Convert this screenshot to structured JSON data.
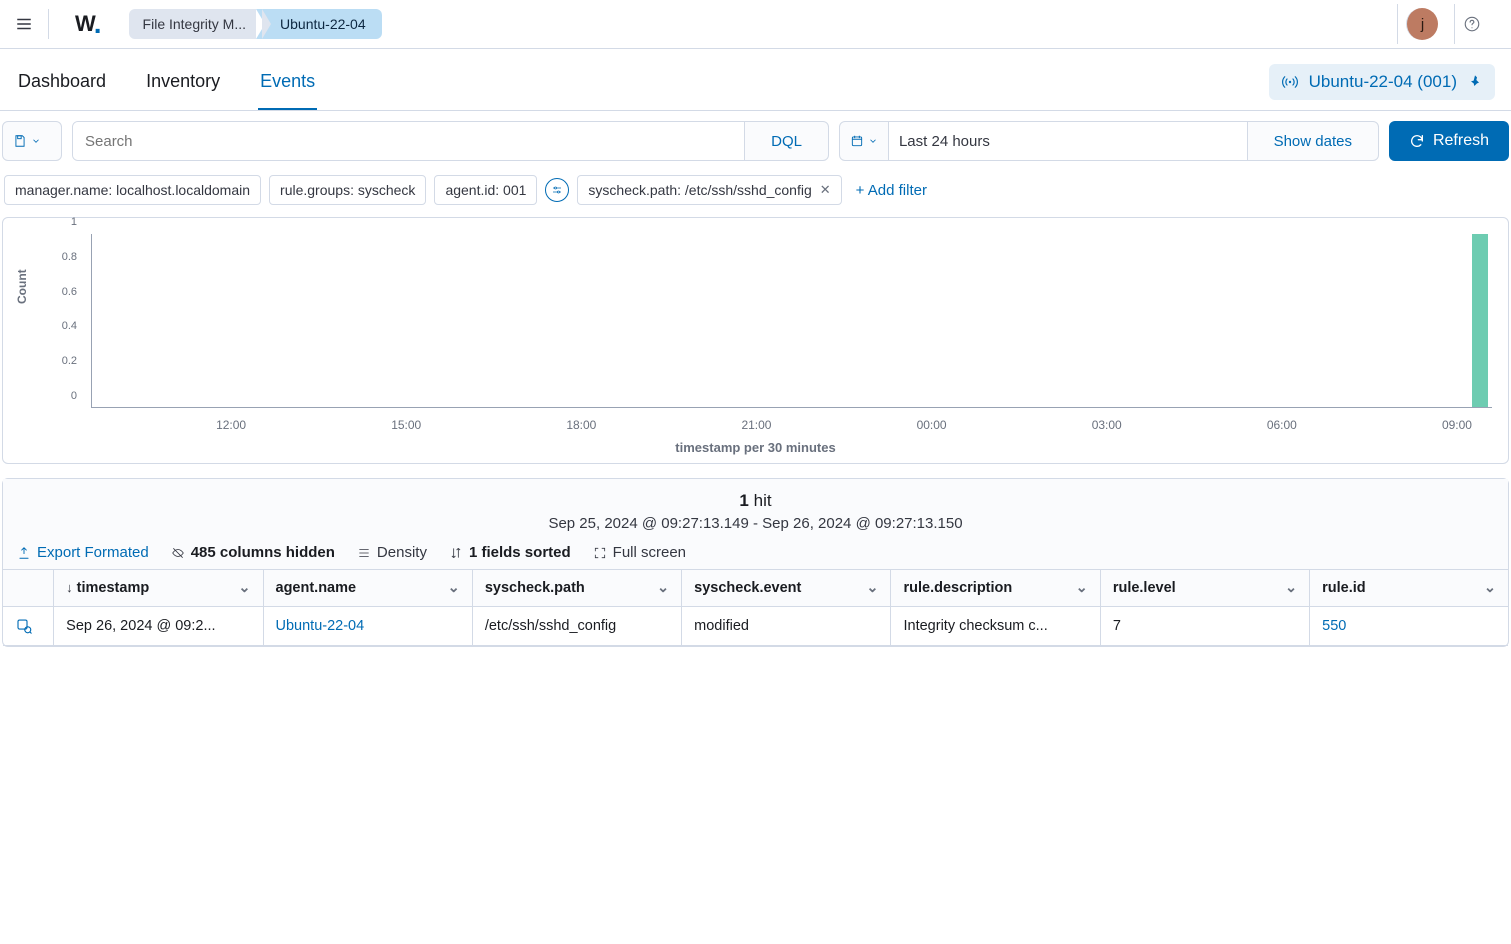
{
  "breadcrumb": {
    "module": "File Integrity M...",
    "agent": "Ubuntu-22-04"
  },
  "user": {
    "avatar_initial": "j"
  },
  "tabs": {
    "dashboard": "Dashboard",
    "inventory": "Inventory",
    "events": "Events"
  },
  "agent_badge": "Ubuntu-22-04 (001)",
  "search": {
    "placeholder": "Search",
    "dql_label": "DQL",
    "timerange": "Last 24 hours",
    "show_dates": "Show dates",
    "refresh": "Refresh"
  },
  "filters": {
    "chips": [
      "manager.name: localhost.localdomain",
      "rule.groups: syscheck",
      "agent.id: 001"
    ],
    "removable_chip": "syscheck.path: /etc/ssh/sshd_config",
    "add_filter": "+ Add filter"
  },
  "chart_data": {
    "type": "bar",
    "ylabel": "Count",
    "xlabel": "timestamp per 30 minutes",
    "ylim": [
      0,
      1
    ],
    "yticks": [
      0,
      0.2,
      0.4,
      0.6,
      0.8,
      1
    ],
    "xticks": [
      "12:00",
      "15:00",
      "18:00",
      "21:00",
      "00:00",
      "03:00",
      "06:00",
      "09:00"
    ],
    "series": [
      {
        "name": "count",
        "x": "09:00",
        "value": 1
      }
    ]
  },
  "results": {
    "hits_count": "1",
    "hits_word": " hit",
    "range_text": "Sep 25, 2024 @ 09:27:13.149 - Sep 26, 2024 @ 09:27:13.150",
    "export_label": "Export Formated",
    "hidden_cols_label": "485 columns hidden",
    "density_label": "Density",
    "sorted_label": "1 fields sorted",
    "fullscreen_label": "Full screen",
    "columns": [
      "timestamp",
      "agent.name",
      "syscheck.path",
      "syscheck.event",
      "rule.description",
      "rule.level",
      "rule.id"
    ],
    "rows": [
      {
        "timestamp": "Sep 26, 2024 @ 09:2...",
        "agent_name": "Ubuntu-22-04",
        "syscheck_path": "/etc/ssh/sshd_config",
        "syscheck_event": "modified",
        "rule_description": "Integrity checksum c...",
        "rule_level": "7",
        "rule_id": "550"
      }
    ]
  }
}
